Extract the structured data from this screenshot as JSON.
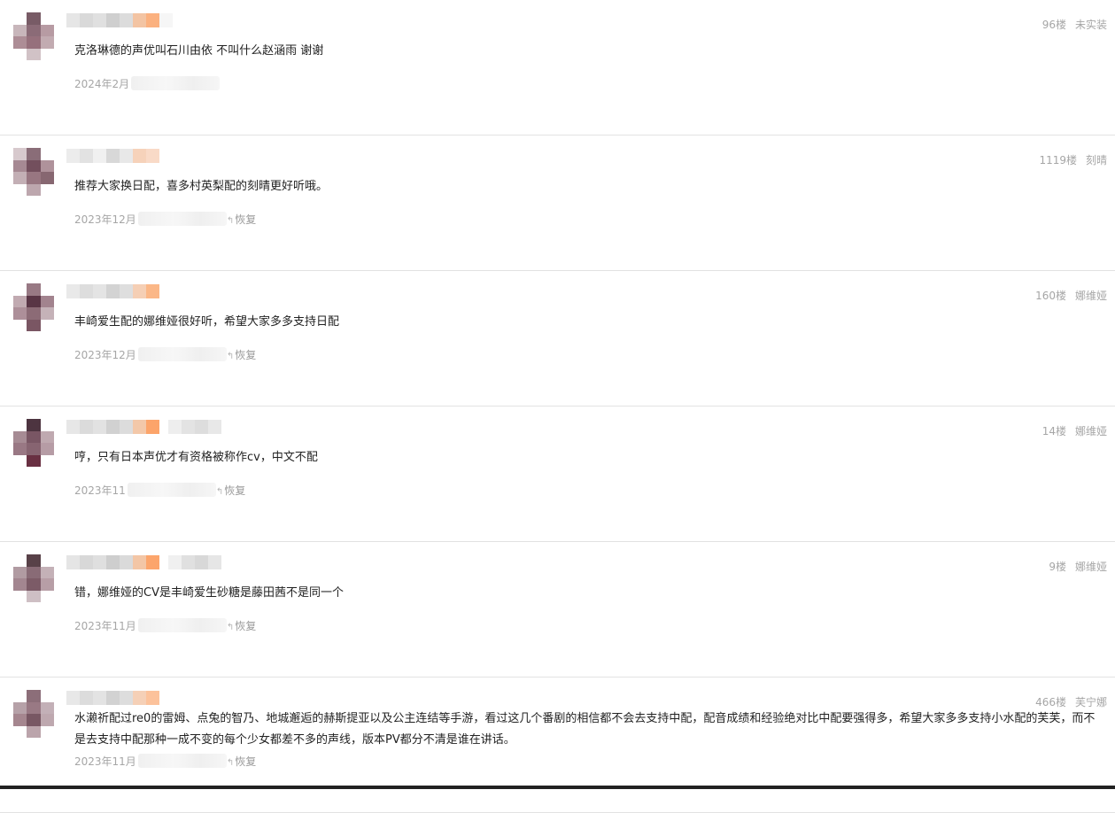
{
  "comments": [
    {
      "content": "克洛琳德的声优叫石川由依 不叫什么赵涵雨 谢谢",
      "date": "2024年2月",
      "reply": "",
      "floor": "96楼",
      "topic": "未实装",
      "avatar": [
        "#ffffff",
        "#7a5a66",
        "#ffffff",
        "#c9b6bb",
        "#8e6a77",
        "#b99aa3",
        "#b08c96",
        "#996f7c",
        "#c4aab1",
        "#ffffff",
        "#d2c2c6",
        "#ffffff"
      ]
    },
    {
      "content": "推荐大家换日配，喜多村英梨配的刻晴更好听哦。",
      "date": "2023年12月",
      "reply": "恢复",
      "floor": "1119楼",
      "topic": "刻晴",
      "avatar": [
        "#d8c9cd",
        "#8d6c78",
        "#ffffff",
        "#a98893",
        "#764e5e",
        "#b1919b",
        "#c5aeb5",
        "#9b7581",
        "#8a6671",
        "#ffffff",
        "#bfa6ae",
        "#ffffff"
      ]
    },
    {
      "content": "丰崎爱生配的娜维娅很好听，希望大家多多支持日配",
      "date": "2023年12月",
      "reply": "恢复",
      "floor": "160楼",
      "topic": "娜维娅",
      "avatar": [
        "#ffffff",
        "#9b7884",
        "#ffffff",
        "#c3a9b1",
        "#5c3446",
        "#a5828e",
        "#b08e99",
        "#8f6a76",
        "#c7b1b8",
        "#ffffff",
        "#7d5563",
        "#ffffff"
      ]
    },
    {
      "content": "哼，只有日本声优才有资格被称作cv，中文不配",
      "date": "2023年11",
      "reply": "恢复",
      "floor": "14楼",
      "topic": "娜维娅",
      "avatar": [
        "#ffffff",
        "#4f3341",
        "#ffffff",
        "#a88a94",
        "#7c5565",
        "#c1a8b0",
        "#9c7784",
        "#8a6371",
        "#b89ba5",
        "#ffffff",
        "#6e2f43",
        "#ffffff"
      ]
    },
    {
      "content": "错，娜维娅的CV是丰崎爱生砂糖是藤田茜不是同一个",
      "date": "2023年11月",
      "reply": "恢复",
      "floor": "9楼",
      "topic": "娜维娅",
      "avatar": [
        "#ffffff",
        "#5a4048",
        "#ffffff",
        "#b39aa2",
        "#8c6a76",
        "#c6b0b7",
        "#a68590",
        "#7f5a67",
        "#b99da6",
        "#ffffff",
        "#cfbfc4",
        "#ffffff"
      ]
    },
    {
      "content": "水濑祈配过re0的雷姆、点兔的智乃、地城邂逅的赫斯提亚以及公主连结等手游，看过这几个番剧的相信都不会去支持中配，配音成绩和经验绝对比中配要强得多，希望大家多多支持小水配的芙芙，而不是去支持中配那种一成不变的每个少女都差不多的声线，版本PV都分不清是谁在讲话。",
      "date": "2023年11月",
      "reply": "恢复",
      "floor": "466楼",
      "topic": "芙宁娜",
      "avatar": [
        "#ffffff",
        "#8f6d79",
        "#ffffff",
        "#b8a0a8",
        "#9c7884",
        "#c5b0b7",
        "#a8858f",
        "#7b5664",
        "#c0a7af",
        "#ffffff",
        "#bda3ab",
        "#ffffff"
      ]
    }
  ]
}
